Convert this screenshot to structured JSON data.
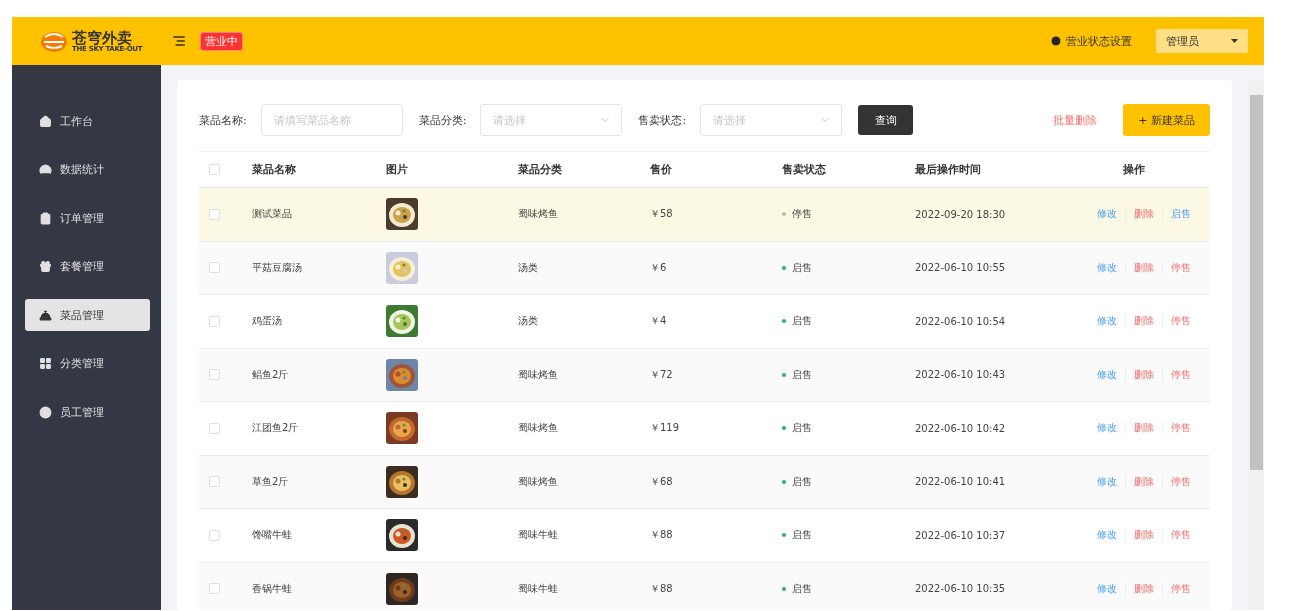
{
  "header": {
    "logo": {
      "title": "苍穹外卖",
      "subtitle": "THE SKY TAKE-OUT"
    },
    "status_badge": "营业中",
    "status_setting": "营业状态设置",
    "user": "管理员"
  },
  "sidebar": {
    "items": [
      {
        "label": "工作台",
        "selected": false
      },
      {
        "label": "数据统计",
        "selected": false
      },
      {
        "label": "订单管理",
        "selected": false
      },
      {
        "label": "套餐管理",
        "selected": false
      },
      {
        "label": "菜品管理",
        "selected": true
      },
      {
        "label": "分类管理",
        "selected": false
      },
      {
        "label": "员工管理",
        "selected": false
      }
    ]
  },
  "filters": [
    {
      "kind": "input",
      "label": "菜品名称:",
      "placeholder": "请填写菜品名称"
    },
    {
      "kind": "select",
      "label": "菜品分类:",
      "placeholder": "请选择"
    },
    {
      "kind": "select",
      "label": "售卖状态:",
      "placeholder": "请选择"
    }
  ],
  "query_button": "查询",
  "batch_delete": "批量删除",
  "new_button": "+ 新建菜品",
  "table": {
    "select_all": false,
    "columns": [
      "菜品名称",
      "图片",
      "菜品分类",
      "售价",
      "售卖状态",
      "最后操作时间",
      "操作"
    ],
    "rows": [
      {
        "name": "测试菜品",
        "category": "蜀味烤鱼",
        "price": "￥58",
        "status": "停售",
        "on_sale": false,
        "time": "2022-09-20 18:30",
        "actions": [
          "修改",
          "删除",
          "启售"
        ],
        "checked": false,
        "hovered": true
      },
      {
        "name": "平菇豆腐汤",
        "category": "汤类",
        "price": "￥6",
        "status": "启售",
        "on_sale": true,
        "time": "2022-06-10 10:55",
        "actions": [
          "修改",
          "删除",
          "停售"
        ],
        "checked": false,
        "hovered": false
      },
      {
        "name": "鸡蛋汤",
        "category": "汤类",
        "price": "￥4",
        "status": "启售",
        "on_sale": true,
        "time": "2022-06-10 10:54",
        "actions": [
          "修改",
          "删除",
          "停售"
        ],
        "checked": false,
        "hovered": false
      },
      {
        "name": "鲳鱼2斤",
        "category": "蜀味烤鱼",
        "price": "￥72",
        "status": "启售",
        "on_sale": true,
        "time": "2022-06-10 10:43",
        "actions": [
          "修改",
          "删除",
          "停售"
        ],
        "checked": false,
        "hovered": false
      },
      {
        "name": "江团鱼2斤",
        "category": "蜀味烤鱼",
        "price": "￥119",
        "status": "启售",
        "on_sale": true,
        "time": "2022-06-10 10:42",
        "actions": [
          "修改",
          "删除",
          "停售"
        ],
        "checked": false,
        "hovered": false
      },
      {
        "name": "草鱼2斤",
        "category": "蜀味烤鱼",
        "price": "￥68",
        "status": "启售",
        "on_sale": true,
        "time": "2022-06-10 10:41",
        "actions": [
          "修改",
          "删除",
          "停售"
        ],
        "checked": false,
        "hovered": false
      },
      {
        "name": "馋嘴牛蛙",
        "category": "蜀味牛蛙",
        "price": "￥88",
        "status": "启售",
        "on_sale": true,
        "time": "2022-06-10 10:37",
        "actions": [
          "修改",
          "删除",
          "停售"
        ],
        "checked": false,
        "hovered": false
      },
      {
        "name": "香锅牛蛙",
        "category": "蜀味牛蛙",
        "price": "￥88",
        "status": "启售",
        "on_sale": true,
        "time": "2022-06-10 10:35",
        "actions": [
          "修改",
          "删除",
          "停售"
        ],
        "checked": false,
        "hovered": false
      }
    ]
  }
}
